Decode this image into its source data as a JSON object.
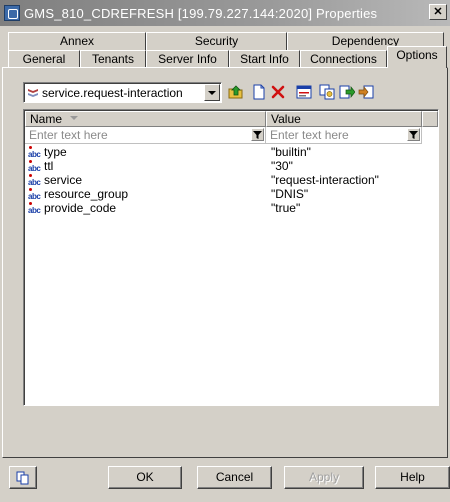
{
  "window": {
    "title": "GMS_810_CDREFRESH [199.79.227.144:2020] Properties",
    "close_label": "✕"
  },
  "tabs": {
    "row1": [
      "Annex",
      "Security",
      "Dependency"
    ],
    "row2": [
      "General",
      "Tenants",
      "Server Info",
      "Start Info",
      "Connections",
      "Options"
    ],
    "active": "Options"
  },
  "toolbar": {
    "section_value": "service.request-interaction",
    "icons": [
      "folder-up-icon",
      "new-item-icon",
      "delete-icon",
      "properties-icon",
      "copy-icon",
      "export-icon",
      "import-icon"
    ]
  },
  "grid": {
    "columns": [
      "Name",
      "Value"
    ],
    "filter_placeholder": "Enter text here",
    "rows": [
      {
        "type_icon": "abc",
        "name": "type",
        "value": "\"builtin\""
      },
      {
        "type_icon": "abc",
        "name": "ttl",
        "value": "\"30\""
      },
      {
        "type_icon": "abc",
        "name": "service",
        "value": "\"request-interaction\""
      },
      {
        "type_icon": "abc",
        "name": "resource_group",
        "value": "\"DNIS\""
      },
      {
        "type_icon": "abc",
        "name": "provide_code",
        "value": "\"true\""
      }
    ]
  },
  "buttons": {
    "ok": "OK",
    "cancel": "Cancel",
    "apply": "Apply",
    "help": "Help"
  }
}
